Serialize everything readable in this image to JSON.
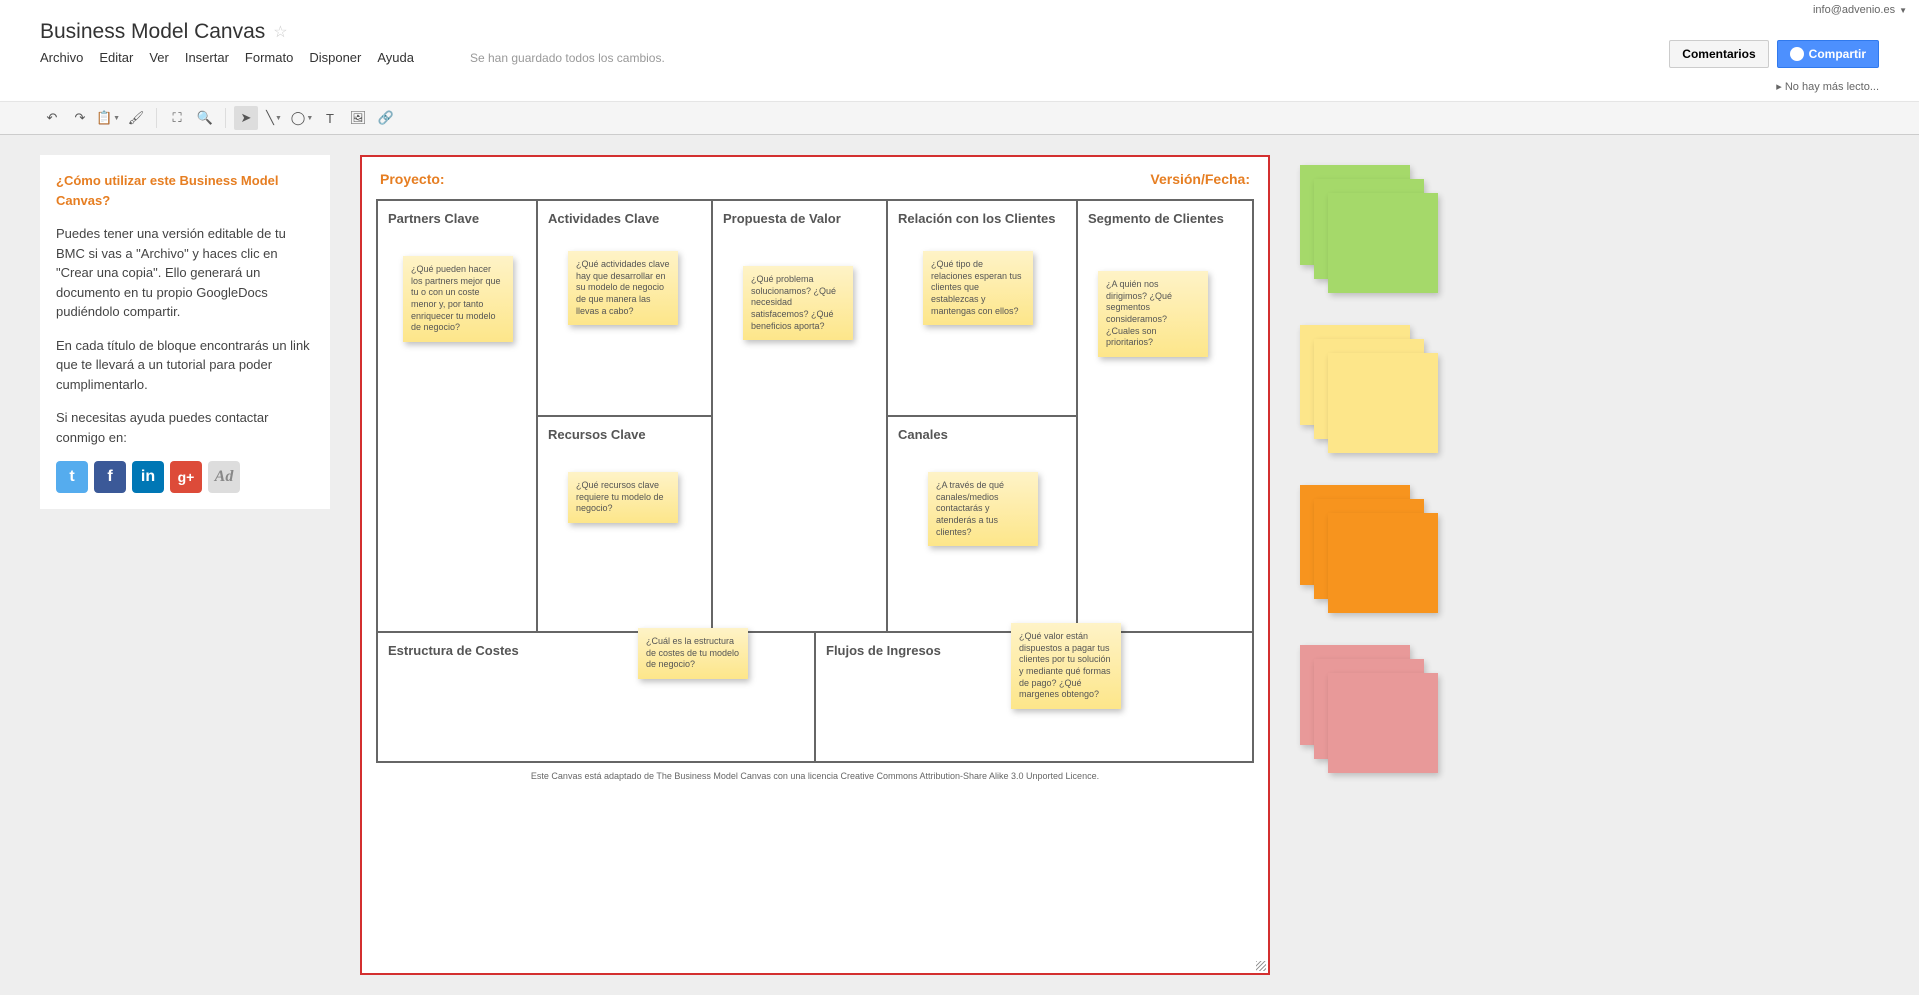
{
  "user_email": "info@advenio.es",
  "doc_title": "Business Model Canvas",
  "menu": [
    "Archivo",
    "Editar",
    "Ver",
    "Insertar",
    "Formato",
    "Disponer",
    "Ayuda"
  ],
  "save_status": "Se han guardado todos los cambios.",
  "comments_btn": "Comentarios",
  "share_btn": "Compartir",
  "no_readers": "No hay más lecto...",
  "side": {
    "title": "¿Cómo utilizar este Business Model Canvas?",
    "p1": "Puedes tener una versión editable de tu BMC si vas a \"Archivo\" y haces clic en \"Crear una copia\". Ello generará un documento en tu propio GoogleDocs pudiéndolo compartir.",
    "p2": "En cada título de bloque encontrarás un link que te llevará a un tutorial para poder cumplimentarlo.",
    "p3": "Si necesitas ayuda puedes contactar conmigo en:"
  },
  "canvas": {
    "proyecto": "Proyecto:",
    "version": "Versión/Fecha:",
    "blocks": {
      "partners": "Partners Clave",
      "activities": "Actividades Clave",
      "value": "Propuesta de Valor",
      "relations": "Relación con los Clientes",
      "segments": "Segmento de Clientes",
      "resources": "Recursos Clave",
      "channels": "Canales",
      "costs": "Estructura de Costes",
      "revenue": "Flujos de Ingresos"
    },
    "notes": {
      "partners": "¿Qué pueden hacer los partners mejor que tu o con un coste menor y, por tanto enriquecer tu modelo de negocio?",
      "activities": "¿Qué actividades clave hay que desarrollar en su modelo de negocio de que manera las llevas a cabo?",
      "value": "¿Qué problema solucionamos? ¿Qué necesidad satisfacemos? ¿Qué beneficios aporta?",
      "relations": "¿Qué tipo de relaciones esperan tus clientes que establezcas y mantengas con ellos?",
      "segments": "¿A quién nos dirigimos? ¿Qué segmentos consideramos? ¿Cuales son prioritarios?",
      "resources": "¿Qué recursos clave requiere tu modelo de negocio?",
      "channels": "¿A través de qué canales/medios contactarás y atenderás a tus clientes?",
      "costs": "¿Cuál es la estructura de costes de tu modelo de negocio?",
      "revenue": "¿Qué valor están dispuestos a pagar tus clientes por tu solución y mediante qué formas de pago? ¿Qué margenes obtengo?"
    },
    "footer": "Este Canvas está adaptado de The Business Model Canvas con una licencia Creative Commons Attribution-Share Alike 3.0 Unported Licence."
  }
}
